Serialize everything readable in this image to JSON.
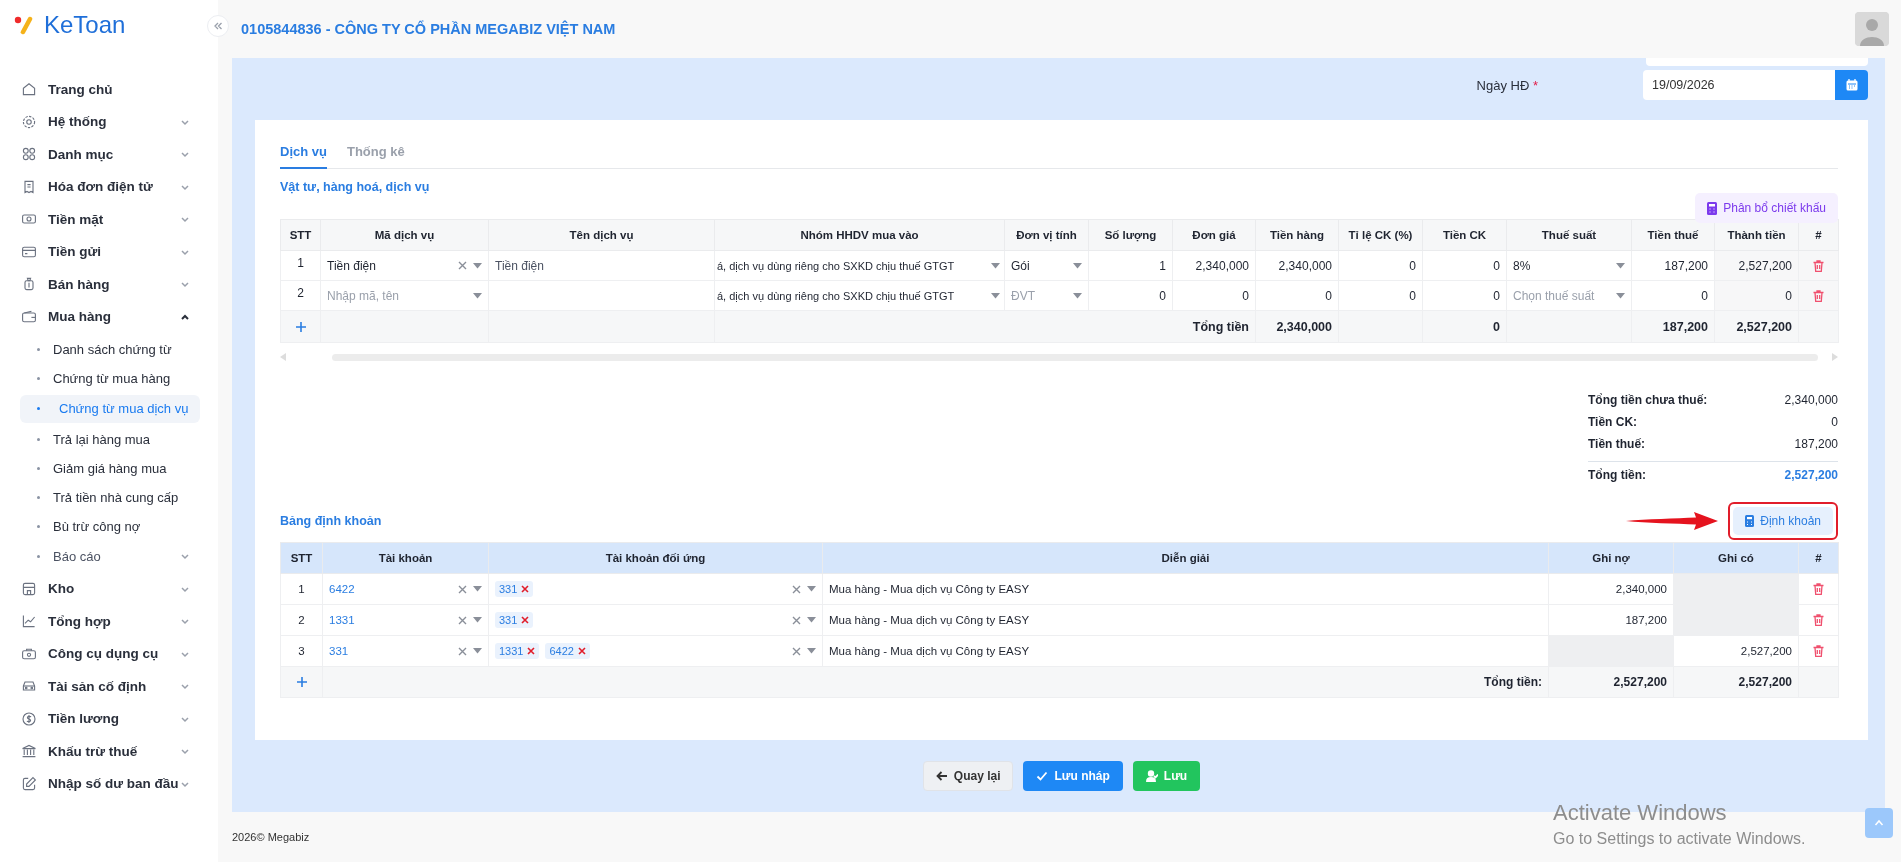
{
  "sidebar": {
    "brand": "KeToan",
    "items": [
      {
        "label": "Trang chủ",
        "kind": "link"
      },
      {
        "label": "Hệ thống",
        "kind": "group",
        "expanded": false
      },
      {
        "label": "Danh mục",
        "kind": "group",
        "expanded": false
      },
      {
        "label": "Hóa đơn điện tử",
        "kind": "group",
        "expanded": false
      },
      {
        "label": "Tiền mặt",
        "kind": "group",
        "expanded": false
      },
      {
        "label": "Tiền gửi",
        "kind": "group",
        "expanded": false
      },
      {
        "label": "Bán hàng",
        "kind": "group",
        "expanded": false
      },
      {
        "label": "Mua hàng",
        "kind": "group",
        "expanded": true,
        "children": [
          {
            "label": "Danh sách chứng từ",
            "kind": "link",
            "selected": false
          },
          {
            "label": "Chứng từ mua hàng",
            "kind": "link",
            "selected": false
          },
          {
            "label": "Chứng từ mua dịch vụ",
            "kind": "link",
            "selected": true
          },
          {
            "label": "Trả lại hàng mua",
            "kind": "link",
            "selected": false
          },
          {
            "label": "Giảm giá hàng mua",
            "kind": "link",
            "selected": false
          },
          {
            "label": "Trả tiền nhà cung cấp",
            "kind": "link",
            "selected": false
          },
          {
            "label": "Bù trừ công nợ",
            "kind": "link",
            "selected": false
          },
          {
            "label": "Báo cáo",
            "kind": "group",
            "selected": false
          }
        ]
      },
      {
        "label": "Kho",
        "kind": "group",
        "expanded": false
      },
      {
        "label": "Tổng hợp",
        "kind": "group",
        "expanded": false
      },
      {
        "label": "Công cụ dụng cụ",
        "kind": "group",
        "expanded": false
      },
      {
        "label": "Tài sản cố định",
        "kind": "group",
        "expanded": false
      },
      {
        "label": "Tiền lương",
        "kind": "group",
        "expanded": false
      },
      {
        "label": "Khấu trừ thuế",
        "kind": "group",
        "expanded": false
      },
      {
        "label": "Nhập số dư ban đầu",
        "kind": "group",
        "expanded": false
      }
    ]
  },
  "header": {
    "company": "0105844836 - CÔNG TY CỔ PHẦN MEGABIZ VIỆT NAM"
  },
  "invoice_date": {
    "label": "Ngày HĐ",
    "required_mark": "*",
    "value": "19/09/2026"
  },
  "tabs": [
    {
      "label": "Dịch vụ",
      "selected": true
    },
    {
      "label": "Thống kê",
      "selected": false
    }
  ],
  "services": {
    "title": "Vật tư, hàng hoá, dịch vụ",
    "action": "Phân bổ chiết khấu",
    "columns": [
      "STT",
      "Mã dịch vụ",
      "Tên dịch vụ",
      "Nhóm HHDV mua vào",
      "Đơn vị tính",
      "Số lượng",
      "Đơn giá",
      "Tiền hàng",
      "Tỉ lệ CK (%)",
      "Tiền CK",
      "Thuế suất",
      "Tiền thuế",
      "Thành tiền",
      "#"
    ],
    "rows": [
      {
        "stt": "1",
        "code": {
          "value": "Tiền điện"
        },
        "name": "Tiền điện",
        "group": "á, dịch vụ dùng riêng cho SXKD chịu thuế GTGT",
        "unit": {
          "value": "Gói"
        },
        "quantity": "1",
        "price": "2,340,000",
        "amount": "2,340,000",
        "discount_rate": "0",
        "discount": "0",
        "tax_rate": {
          "value": "8%"
        },
        "tax": "187,200",
        "total": "2,527,200"
      },
      {
        "stt": "2",
        "code": {
          "placeholder": "Nhập mã, tên"
        },
        "group": "á, dịch vụ dùng riêng cho SXKD chịu thuế GTGT",
        "unit": {
          "placeholder": "ĐVT"
        },
        "quantity": "0",
        "price": "0",
        "amount": "0",
        "discount_rate": "0",
        "discount": "0",
        "tax_rate": {
          "placeholder": "Chọn thuế suất"
        },
        "tax": "0",
        "total": "0"
      }
    ],
    "total": {
      "label": "Tổng tiền",
      "amount": "2,340,000",
      "discount": "0",
      "tax": "187,200",
      "total": "2,527,200"
    }
  },
  "summary": [
    {
      "label": "Tổng tiền chưa thuế:",
      "value": "2,340,000",
      "kind": "plain"
    },
    {
      "label": "Tiền CK:",
      "value": "0",
      "kind": "plain"
    },
    {
      "label": "Tiền thuế:",
      "value": "187,200",
      "kind": "plain"
    },
    {
      "label": "Tổng tiền:",
      "value": "2,527,200",
      "kind": "total"
    }
  ],
  "entries": {
    "title": "Bảng định khoản",
    "action": "Định khoản",
    "highlighted": true,
    "columns": [
      "STT",
      "Tài khoản",
      "Tài khoản đối ứng",
      "Diễn giải",
      "Ghi nợ",
      "Ghi có",
      "#"
    ],
    "rows": [
      {
        "stt": "1",
        "account": "6422",
        "contra": [
          "331"
        ],
        "description": "Mua hàng - Mua dịch vụ Công ty EASY",
        "debit": {
          "value": "2,340,000",
          "disabled": false
        },
        "credit": {
          "disabled": true
        }
      },
      {
        "stt": "2",
        "account": "1331",
        "contra": [
          "331"
        ],
        "description": "Mua hàng - Mua dịch vụ Công ty EASY",
        "debit": {
          "value": "187,200",
          "disabled": false
        },
        "credit": {
          "disabled": true
        }
      },
      {
        "stt": "3",
        "account": "331",
        "contra": [
          "1331",
          "6422"
        ],
        "description": "Mua hàng - Mua dịch vụ Công ty EASY",
        "debit": {
          "disabled": true
        },
        "credit": {
          "value": "2,527,200",
          "disabled": false
        }
      }
    ],
    "total": {
      "label": "Tổng tiền:",
      "debit": "2,527,200",
      "credit": "2,527,200"
    }
  },
  "actions": [
    {
      "label": "Quay lại",
      "kind": "back"
    },
    {
      "label": "Lưu nháp",
      "kind": "draft"
    },
    {
      "label": "Lưu",
      "kind": "save"
    }
  ],
  "footer": "2026© Megabiz",
  "os_notice": {
    "title": "Activate Windows",
    "text": "Go to Settings to activate Windows."
  }
}
